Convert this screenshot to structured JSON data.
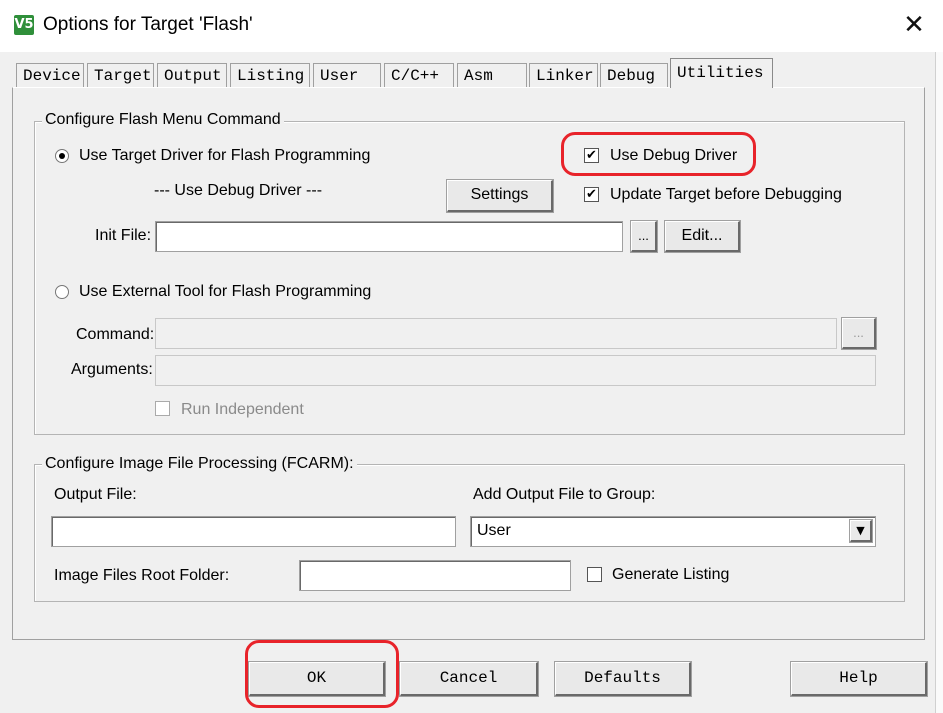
{
  "window": {
    "title": "Options for Target 'Flash'",
    "app_icon": "V5",
    "close_glyph": "✕"
  },
  "tabs": [
    {
      "label": "Device"
    },
    {
      "label": "Target"
    },
    {
      "label": "Output"
    },
    {
      "label": "Listing"
    },
    {
      "label": "User"
    },
    {
      "label": "C/C++"
    },
    {
      "label": "Asm"
    },
    {
      "label": "Linker"
    },
    {
      "label": "Debug"
    },
    {
      "label": "Utilities",
      "active": true
    }
  ],
  "flash_group": {
    "title": "Configure Flash Menu Command",
    "use_target_driver_label": "Use Target Driver for Flash Programming",
    "use_target_driver_selected": true,
    "driver_name": "--- Use Debug Driver ---",
    "settings_label": "Settings",
    "use_debug_driver_label": "Use Debug Driver",
    "use_debug_driver_checked": true,
    "update_target_label": "Update Target before Debugging",
    "update_target_checked": true,
    "init_file_label": "Init File:",
    "init_file_value": "",
    "browse_label": "...",
    "edit_label": "Edit...",
    "use_external_tool_label": "Use External Tool for Flash Programming",
    "use_external_tool_selected": false,
    "command_label": "Command:",
    "command_value": "",
    "command_browse_label": "...",
    "arguments_label": "Arguments:",
    "arguments_value": "",
    "run_independent_label": "Run Independent",
    "run_independent_checked": false
  },
  "image_group": {
    "title": "Configure Image File Processing (FCARM):",
    "output_file_label": "Output File:",
    "output_file_value": "",
    "add_output_label": "Add Output File  to Group:",
    "group_selected": "User",
    "root_folder_label": "Image Files Root Folder:",
    "root_folder_value": "",
    "generate_listing_label": "Generate Listing",
    "generate_listing_checked": false
  },
  "buttons": {
    "ok": "OK",
    "cancel": "Cancel",
    "defaults": "Defaults",
    "help": "Help"
  },
  "colors": {
    "highlight_ring": "#e8232a",
    "dialog_bg": "#f0f0f0"
  }
}
